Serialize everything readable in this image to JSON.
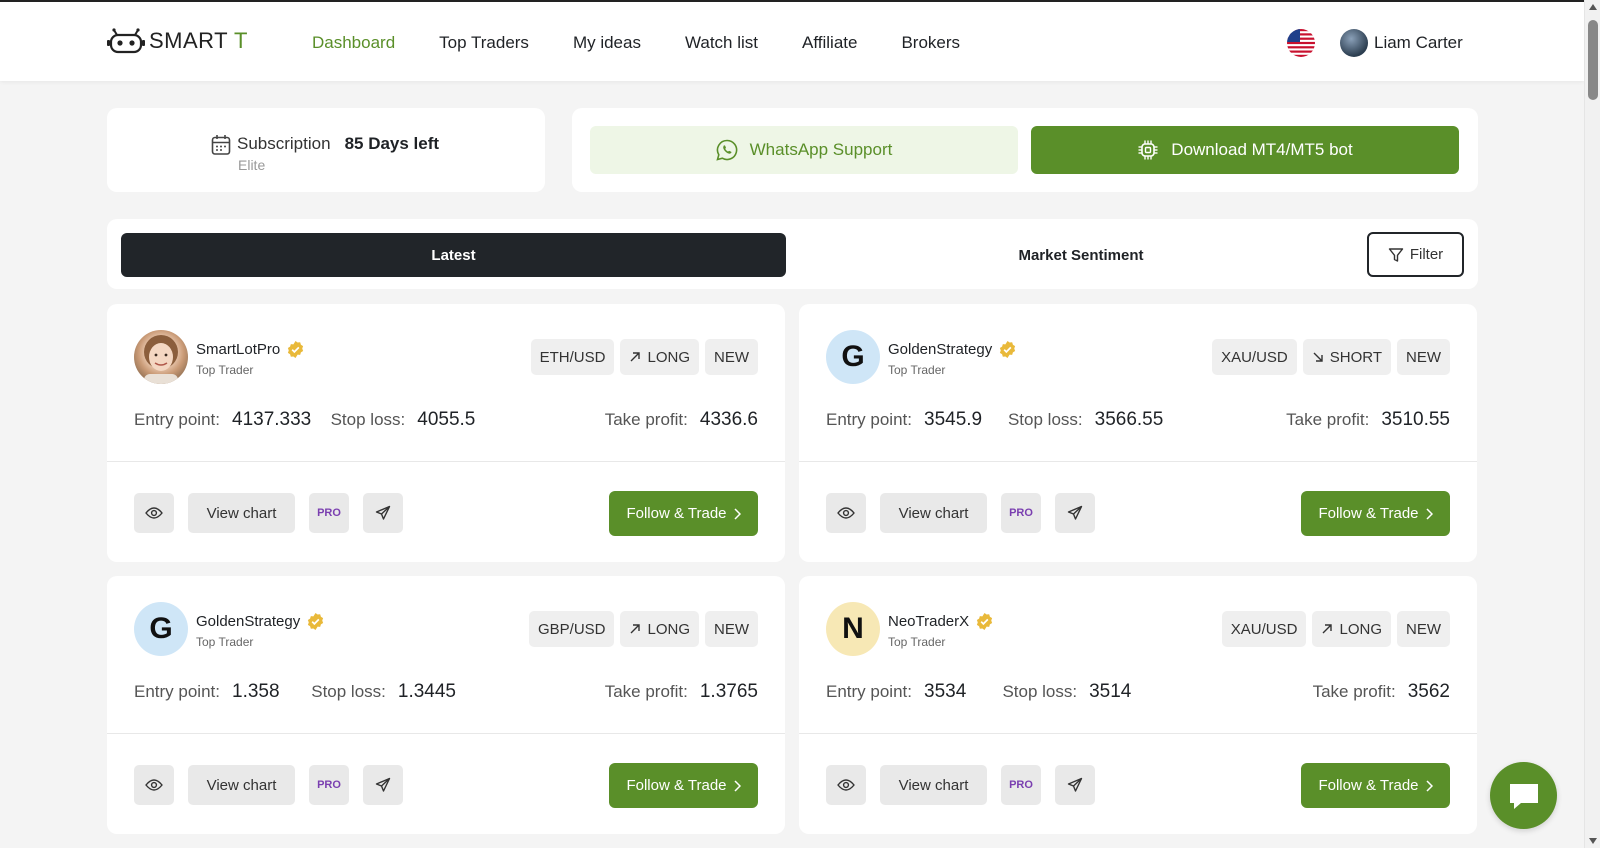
{
  "brand": {
    "name_main": "SMART",
    "name_accent": "T"
  },
  "nav": {
    "items": [
      {
        "label": "Dashboard",
        "active": true
      },
      {
        "label": "Top Traders",
        "active": false
      },
      {
        "label": "My ideas",
        "active": false
      },
      {
        "label": "Watch list",
        "active": false
      },
      {
        "label": "Affiliate",
        "active": false
      },
      {
        "label": "Brokers",
        "active": false
      }
    ]
  },
  "user": {
    "name": "Liam Carter",
    "flag_icon": "us-flag-icon"
  },
  "subscription": {
    "label": "Subscription",
    "days_left": "85 Days left",
    "tier": "Elite"
  },
  "support": {
    "whatsapp_label": "WhatsApp Support",
    "download_label": "Download MT4/MT5 bot"
  },
  "tabs": {
    "latest": "Latest",
    "sentiment": "Market Sentiment",
    "filter": "Filter"
  },
  "card_labels": {
    "entry": "Entry point:",
    "stop": "Stop loss:",
    "take": "Take profit:",
    "view_chart": "View chart",
    "pro": "PRO",
    "follow": "Follow & Trade"
  },
  "cards": [
    {
      "avatar_letter": "",
      "name": "SmartLotPro",
      "role": "Top Trader",
      "pair": "ETH/USD",
      "direction": "LONG",
      "status": "NEW",
      "entry": "4137.333",
      "stop": "4055.5",
      "take": "4336.6"
    },
    {
      "avatar_letter": "G",
      "name": "GoldenStrategy",
      "role": "Top Trader",
      "pair": "XAU/USD",
      "direction": "SHORT",
      "status": "NEW",
      "entry": "3545.9",
      "stop": "3566.55",
      "take": "3510.55"
    },
    {
      "avatar_letter": "G",
      "name": "GoldenStrategy",
      "role": "Top Trader",
      "pair": "GBP/USD",
      "direction": "LONG",
      "status": "NEW",
      "entry": "1.358",
      "stop": "1.3445",
      "take": "1.3765"
    },
    {
      "avatar_letter": "N",
      "name": "NeoTraderX",
      "role": "Top Trader",
      "pair": "XAU/USD",
      "direction": "LONG",
      "status": "NEW",
      "entry": "3534",
      "stop": "3514",
      "take": "3562"
    }
  ],
  "colors": {
    "accent": "#5a8f29",
    "dark": "#212529",
    "pro": "#7a3fb0"
  }
}
